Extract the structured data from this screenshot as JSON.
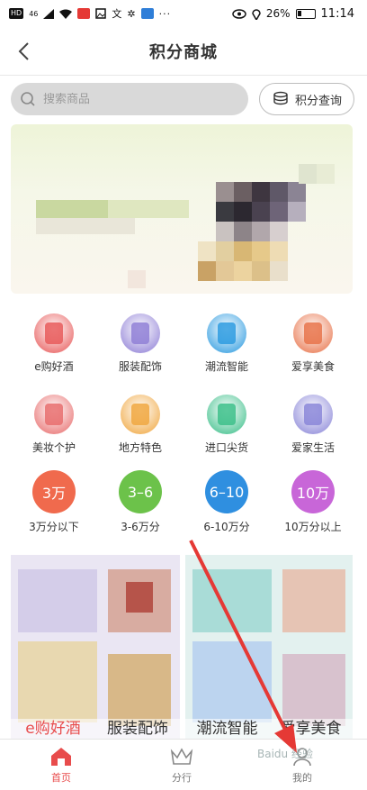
{
  "status_bar": {
    "hd_label": "HD",
    "signal_label": "46",
    "battery_percent": "26%",
    "time": "11:14"
  },
  "header": {
    "title": "积分商城"
  },
  "search": {
    "placeholder": "搜索商品",
    "points_query_label": "积分查询"
  },
  "categories": [
    {
      "label": "e购好酒",
      "icon": "wine-icon",
      "color": "#e85a5a"
    },
    {
      "label": "服装配饰",
      "icon": "clothing-icon",
      "color": "#8f7fd6"
    },
    {
      "label": "潮流智能",
      "icon": "smart-device-icon",
      "color": "#2d9be0"
    },
    {
      "label": "爱享美食",
      "icon": "food-icon",
      "color": "#e8734a"
    },
    {
      "label": "美妆个护",
      "icon": "cosmetics-icon",
      "color": "#e86d6d"
    },
    {
      "label": "地方特色",
      "icon": "local-specialty-icon",
      "color": "#f0a740"
    },
    {
      "label": "进口尖货",
      "icon": "imported-goods-icon",
      "color": "#3cbf8a"
    },
    {
      "label": "爱家生活",
      "icon": "home-life-icon",
      "color": "#8a86d8"
    }
  ],
  "point_ranges": [
    {
      "badge": "3万",
      "label": "3万分以下",
      "color": "#f06a4d"
    },
    {
      "badge": "3–6",
      "label": "3-6万分",
      "color": "#6cc24a"
    },
    {
      "badge": "6–10",
      "label": "6-10万分",
      "color": "#2f8fe0"
    },
    {
      "badge": "10万",
      "label": "10万分以上",
      "color": "#c866d8"
    }
  ],
  "products": [
    {
      "label": "e购好酒"
    },
    {
      "label": "服装配饰"
    },
    {
      "label": "潮流智能"
    },
    {
      "label": "爱享美食"
    }
  ],
  "tabs": [
    {
      "label": "首页",
      "icon": "home-icon",
      "active": true
    },
    {
      "label": "分行",
      "icon": "crown-icon",
      "active": false
    },
    {
      "label": "我的",
      "icon": "user-icon",
      "active": false
    }
  ],
  "watermark": "Baidu 经验",
  "colors": {
    "accent": "#e84c4c",
    "arrow": "#e53935"
  }
}
